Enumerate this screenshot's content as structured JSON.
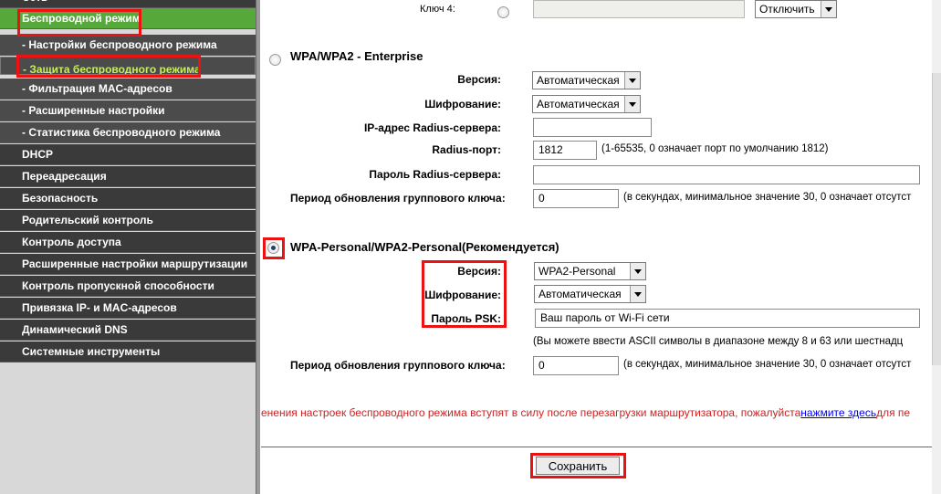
{
  "sidebar": {
    "items": [
      {
        "label": "Сеть",
        "kind": "main"
      },
      {
        "label": "Беспроводной режим",
        "kind": "main",
        "state": "active"
      },
      {
        "label": "- Настройки беспроводного режима",
        "kind": "sub"
      },
      {
        "label": "- Защита беспроводного режима",
        "kind": "sub",
        "state": "selected"
      },
      {
        "label": "- Фильтрация MAC-адресов",
        "kind": "sub"
      },
      {
        "label": "- Расширенные настройки",
        "kind": "sub"
      },
      {
        "label": "- Статистика беспроводного режима",
        "kind": "sub"
      },
      {
        "label": "DHCP",
        "kind": "main"
      },
      {
        "label": "Переадресация",
        "kind": "main"
      },
      {
        "label": "Безопасность",
        "kind": "main"
      },
      {
        "label": "Родительский контроль",
        "kind": "main"
      },
      {
        "label": "Контроль доступа",
        "kind": "main"
      },
      {
        "label": "Расширенные настройки маршрутизации",
        "kind": "main"
      },
      {
        "label": "Контроль пропускной способности",
        "kind": "main"
      },
      {
        "label": "Привязка IP- и MAC-адресов",
        "kind": "main"
      },
      {
        "label": "Динамический DNS",
        "kind": "main"
      },
      {
        "label": "Системные инструменты",
        "kind": "main"
      }
    ]
  },
  "wep": {
    "key4_label": "Ключ 4:",
    "key4_value": "",
    "key4_state_value": "Отключить"
  },
  "enterprise": {
    "title": "WPA/WPA2 - Enterprise",
    "selected": false,
    "version_label": "Версия:",
    "version_value": "Автоматическая",
    "encryption_label": "Шифрование:",
    "encryption_value": "Автоматическая",
    "radius_ip_label": "IP-адрес Radius-сервера:",
    "radius_ip_value": "",
    "radius_port_label": "Radius-порт:",
    "radius_port_value": "1812",
    "radius_port_hint": "(1-65535, 0 означает порт по умолчанию 1812)",
    "radius_password_label": "Пароль Radius-сервера:",
    "radius_password_value": "",
    "group_key_label": "Период обновления группового ключа:",
    "group_key_value": "0",
    "group_key_hint": "(в секундах, минимальное значение 30, 0 означает отсутст"
  },
  "personal": {
    "title": "WPA-Personal/WPA2-Personal(Рекомендуется)",
    "selected": true,
    "version_label": "Версия:",
    "version_value": "WPA2-Personal",
    "encryption_label": "Шифрование:",
    "encryption_value": "Автоматическая",
    "psk_label": "Пароль PSK:",
    "psk_value": "Ваш пароль от Wi-Fi сети",
    "psk_hint": "(Вы можете ввести ASCII символы в диапазоне между 8 и 63 или шестнадц",
    "group_key_label": "Период обновления группового ключа:",
    "group_key_value": "0",
    "group_key_hint": "(в секундах, минимальное значение 30, 0 означает отсутст"
  },
  "notice": {
    "text_before": "енения настроек беспроводного режима вступят в силу после перезагрузки маршрутизатора, пожалуйста",
    "link": "нажмите здесь",
    "text_after": "для пе"
  },
  "save_label": "Сохранить",
  "colors": {
    "sidebar_main": "#3a3a3a",
    "sidebar_active": "#57a83a",
    "sidebar_selected_text": "#c8ee5c",
    "highlight": "#ee1111",
    "notice": "#cc2222"
  }
}
